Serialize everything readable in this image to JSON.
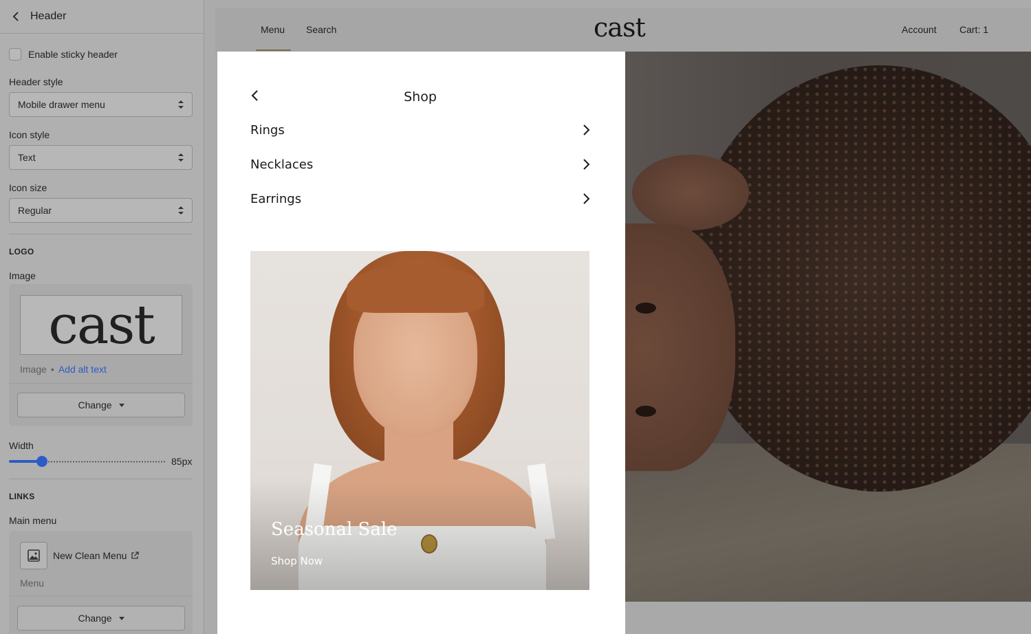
{
  "sidebar": {
    "title": "Header",
    "sticky_label": "Enable sticky header",
    "header_style": {
      "label": "Header style",
      "value": "Mobile drawer menu"
    },
    "icon_style": {
      "label": "Icon style",
      "value": "Text"
    },
    "icon_size": {
      "label": "Icon size",
      "value": "Regular"
    },
    "logo": {
      "section": "LOGO",
      "image_label": "Image",
      "thumb_text": "cast",
      "meta_type": "Image",
      "meta_link": "Add alt text",
      "change_label": "Change"
    },
    "width": {
      "label": "Width",
      "value": "85px",
      "fraction": 0.19
    },
    "links": {
      "section": "LINKS",
      "menu_label": "Main menu",
      "menu_name": "New Clean Menu",
      "menu_sub": "Menu",
      "change_label": "Change"
    }
  },
  "preview": {
    "nav": {
      "menu": "Menu",
      "search": "Search",
      "account": "Account",
      "cart": "Cart: 1"
    },
    "brand": "cast",
    "drawer": {
      "title": "Shop",
      "items": [
        "Rings",
        "Necklaces",
        "Earrings"
      ]
    },
    "promo": {
      "title": "Seasonal Sale",
      "link": "Shop Now"
    }
  },
  "colors": {
    "accent": "#2c5cc5",
    "nav_underline": "#7a6b4c"
  }
}
